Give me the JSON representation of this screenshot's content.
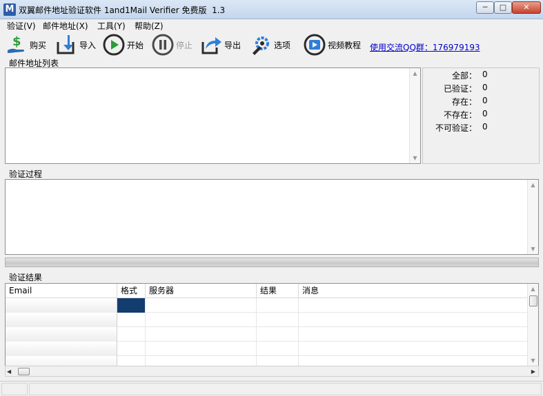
{
  "window": {
    "title": "双翼邮件地址验证软件 1and1Mail Verifier 免费版  1.3",
    "min_glyph": "─",
    "max_glyph": "□",
    "close_glyph": "✕"
  },
  "menu": [
    {
      "label": "验证(V)"
    },
    {
      "label": "邮件地址(X)"
    },
    {
      "label": "工具(Y)"
    },
    {
      "label": "帮助(Z)"
    }
  ],
  "toolbar": {
    "buy": {
      "label": "购买",
      "icon": "dollar-hand-icon"
    },
    "import": {
      "label": "导入",
      "icon": "import-icon"
    },
    "start": {
      "label": "开始",
      "icon": "play-icon"
    },
    "stop": {
      "label": "停止",
      "icon": "pause-icon",
      "disabled": true
    },
    "export": {
      "label": "导出",
      "icon": "export-icon"
    },
    "options": {
      "label": "选项",
      "icon": "wrench-gear-icon"
    },
    "video": {
      "label": "视频教程",
      "icon": "video-play-icon"
    },
    "qq_link": "使用交流QQ群：176979193"
  },
  "sections": {
    "address_list": "邮件地址列表",
    "process": "验证过程",
    "results": "验证结果"
  },
  "stats": [
    {
      "label": "全部：",
      "value": "0"
    },
    {
      "label": "已验证：",
      "value": "0"
    },
    {
      "label": "存在：",
      "value": "0"
    },
    {
      "label": "不存在：",
      "value": "0"
    },
    {
      "label": "不可验证：",
      "value": "0"
    }
  ],
  "results_table": {
    "columns": [
      "Email",
      "格式",
      "服务器",
      "结果",
      "消息"
    ],
    "rows": 5
  },
  "colors": {
    "accent": "#2d5fa8",
    "selected_cell": "#123d6e",
    "link": "#0000cc",
    "icon_dark": "#2b2b2b",
    "icon_green": "#2a9d3a",
    "icon_blue": "#2f7ed8"
  }
}
